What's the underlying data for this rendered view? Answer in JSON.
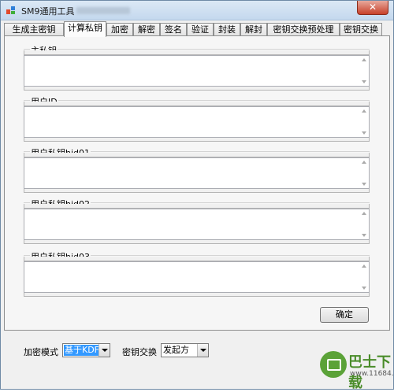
{
  "window": {
    "title": "SM9通用工具",
    "close": "✕"
  },
  "tabs": [
    "生成主密钥",
    "计算私钥",
    "加密",
    "解密",
    "签名",
    "验证",
    "封装",
    "解封",
    "密钥交换预处理",
    "密钥交换"
  ],
  "active_tab": "计算私钥",
  "groups": [
    {
      "label": "主私钥",
      "value": ""
    },
    {
      "label": "用户ID",
      "value": ""
    },
    {
      "label": "用户私钥hid01",
      "value": ""
    },
    {
      "label": "用户私钥hid02",
      "value": ""
    },
    {
      "label": "用户私钥hid03",
      "value": ""
    }
  ],
  "ok_button": "确定",
  "bottom": {
    "encrypt_mode_label": "加密模式",
    "encrypt_mode_value": "基于KDF",
    "key_exchange_label": "密钥交换",
    "key_exchange_value": "发起方"
  },
  "watermark": {
    "text": "巴士下载",
    "url": "www.11684.com"
  }
}
